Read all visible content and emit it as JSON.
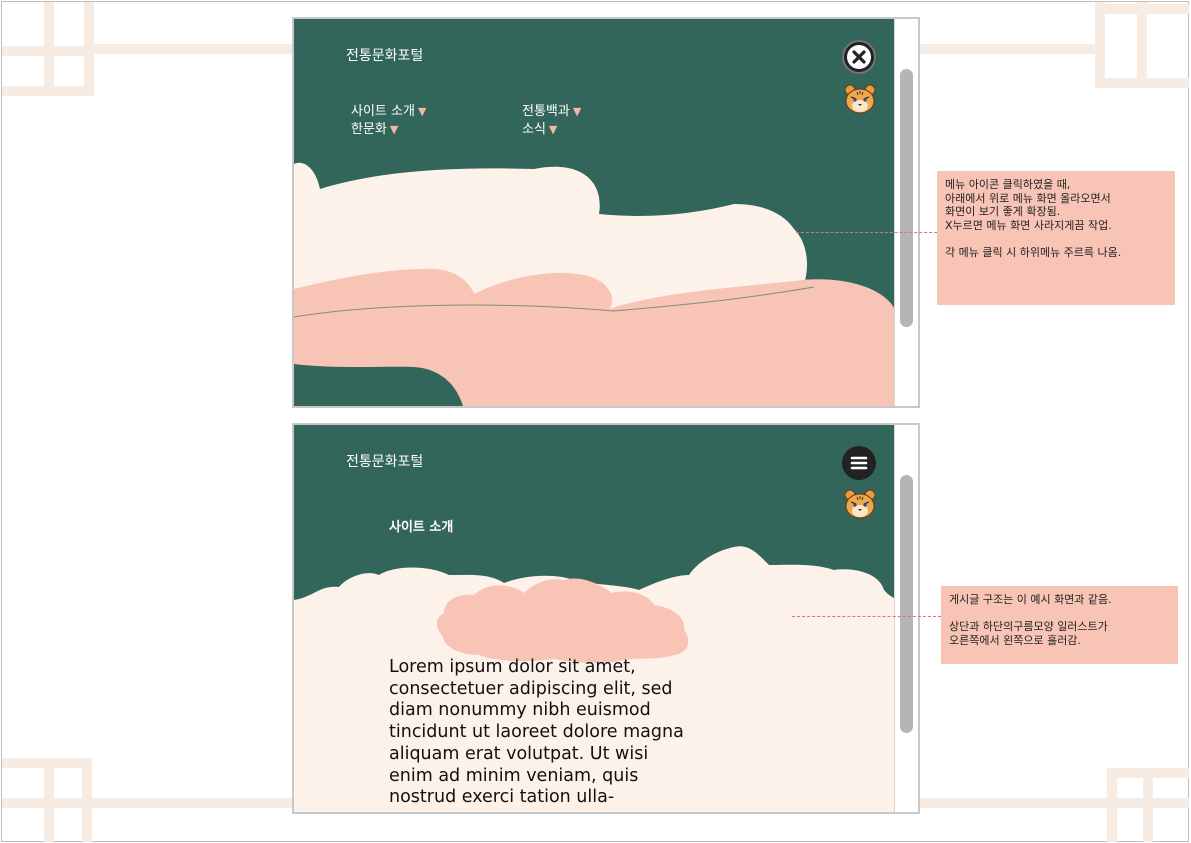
{
  "colors": {
    "forest": "#33665a",
    "cream": "#fdf2ea",
    "salmon": "#f8c4b5",
    "frame": "#f7ece3"
  },
  "menu_screen": {
    "title": "전통문화포털",
    "close_icon": "close-icon",
    "mascot": "tiger-icon",
    "nav": [
      {
        "label": "사이트 소개",
        "caret": "▼"
      },
      {
        "label": "전통백과",
        "caret": "▼"
      },
      {
        "label": "한문화",
        "caret": "▼"
      },
      {
        "label": "소식",
        "caret": "▼"
      }
    ]
  },
  "content_screen": {
    "title": "전통문화포털",
    "menu_icon": "hamburger-icon",
    "mascot": "tiger-icon",
    "section_label": "사이트 소개",
    "body_text": "Lorem ipsum dolor sit amet, consectetuer adipiscing elit, sed diam nonummy nibh euismod tincidunt ut laoreet dolore magna aliquam erat volutpat. Ut wisi enim ad minim veniam, quis nostrud exerci tation ulla-"
  },
  "notes": {
    "menu_note": "메뉴 아이콘 클릭하였을 때,\n아래에서 위로 메뉴 화면 올라오면서\n화면이 보기 좋게 확장됨.\nX누르면 메뉴 화면 사라지게끔 작업.\n\n각 메뉴 클릭 시 하위메뉴 주르륵 나옴.",
    "content_note": "게시글 구조는 이 예시 화면과 같음.\n\n상단과 하단의구름모양 일러스트가\n오른쪽에서 왼쪽으로 흘러감."
  }
}
